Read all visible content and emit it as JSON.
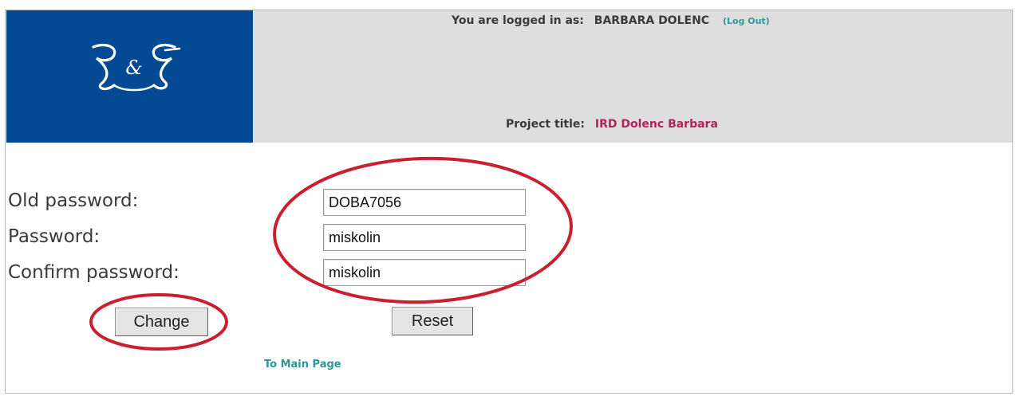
{
  "header": {
    "logo_text": "R&F",
    "logged_in_label": "You are logged in as:",
    "username": "BARBARA DOLENC",
    "logout_label": "(Log Out)",
    "project_label": "Project title:",
    "project_title": "IRD Dolenc Barbara"
  },
  "form": {
    "old_password_label": "Old password:",
    "old_password_value": "DOBA7056",
    "password_label": "Password:",
    "password_value": "miskolin",
    "confirm_label": "Confirm password:",
    "confirm_value": "miskolin",
    "change_button": "Change",
    "reset_button": "Reset"
  },
  "footer": {
    "main_page_link": "To Main Page"
  },
  "colors": {
    "logo_background": "#034993",
    "header_background": "#dedede",
    "project_title_color": "#b3245a",
    "link_color": "#2a9696",
    "annotation_red": "#c8202f"
  }
}
